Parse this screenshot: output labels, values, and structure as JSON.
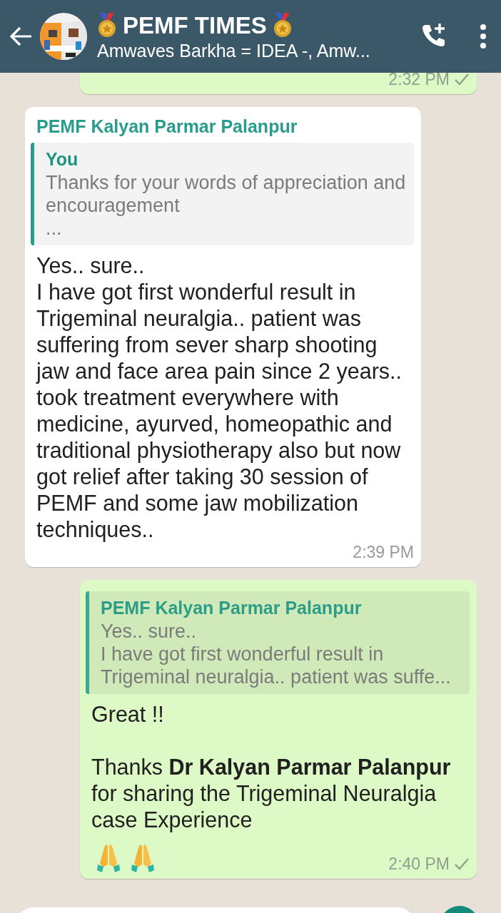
{
  "header": {
    "title": "PEMF TIMES",
    "subtitle": "Amwaves Barkha = IDEA -, Amw..."
  },
  "messages": [
    {
      "kind": "outgoing",
      "time": "2:32 PM",
      "delivered": true
    },
    {
      "kind": "incoming",
      "sender": "PEMF Kalyan Parmar Palanpur",
      "quote": {
        "author": "You",
        "text": "Thanks for your words of appreciation and encouragement\n..."
      },
      "text": "Yes.. sure..\nI have got first wonderful result in Trigeminal neuralgia.. patient was suffering from sever sharp shooting jaw and face area pain since 2 years.. took treatment everywhere with medicine, ayurved, homeopathic and traditional physiotherapy also but now got relief after taking 30 session of   PEMF and some jaw mobilization techniques..",
      "time": "2:39 PM"
    },
    {
      "kind": "outgoing",
      "quote": {
        "author": "PEMF Kalyan Parmar Palanpur",
        "text": "Yes.. sure..\nI have got first wonderful result in\nTrigeminal neuralgia.. patient was suffe..."
      },
      "text": "Great !!\n\nThanks **Dr Kalyan Parmar Palanpur** for sharing the Trigeminal Neuralgia case Experience",
      "time": "2:40 PM",
      "delivered": true,
      "trailing_emoji": true
    }
  ]
}
